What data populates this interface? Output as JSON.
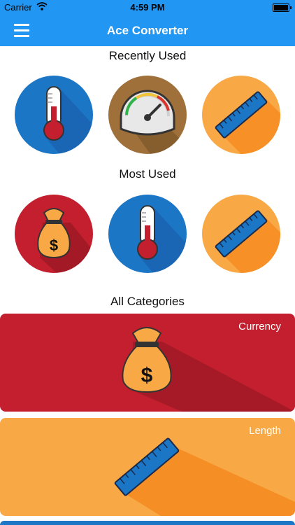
{
  "status_bar": {
    "carrier": "Carrier",
    "time": "4:59 PM"
  },
  "nav": {
    "title": "Ace Converter",
    "menu_icon": "hamburger-menu-icon"
  },
  "sections": {
    "recent": "Recently Used",
    "most": "Most Used",
    "all": "All Categories"
  },
  "recent_items": [
    {
      "icon": "thermometer-icon",
      "color": "#1b76c6"
    },
    {
      "icon": "speedometer-icon",
      "color": "#a0703a"
    },
    {
      "icon": "ruler-icon",
      "color": "#f8a945"
    }
  ],
  "most_items": [
    {
      "icon": "money-bag-icon",
      "color": "#c41f2f"
    },
    {
      "icon": "thermometer-icon",
      "color": "#1b76c6"
    },
    {
      "icon": "ruler-icon",
      "color": "#f8a945"
    }
  ],
  "categories": [
    {
      "label": "Currency",
      "icon": "money-bag-icon",
      "color": "#c41f2f"
    },
    {
      "label": "Length",
      "icon": "ruler-icon",
      "color": "#f8a945"
    }
  ],
  "colors": {
    "accent": "#2196f3"
  }
}
